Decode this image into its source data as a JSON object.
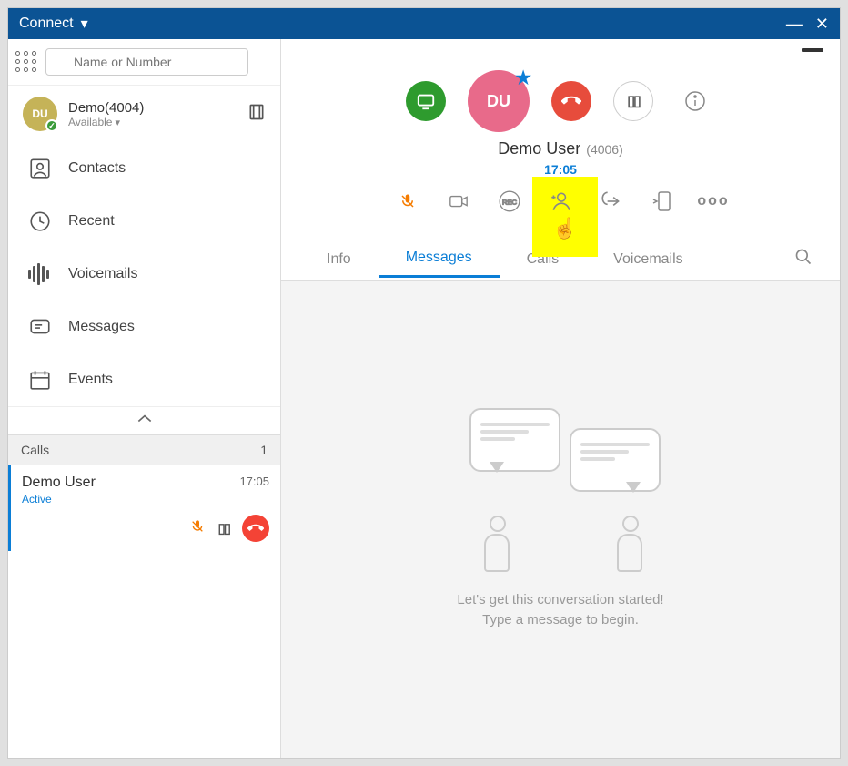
{
  "app_title": "Connect",
  "search": {
    "placeholder": "Name or Number"
  },
  "profile": {
    "initials": "DU",
    "name": "Demo(4004)",
    "status": "Available"
  },
  "nav": {
    "contacts": "Contacts",
    "recent": "Recent",
    "voicemails": "Voicemails",
    "messages": "Messages",
    "events": "Events"
  },
  "calls_section": {
    "header": "Calls",
    "count": "1",
    "item": {
      "name": "Demo User",
      "time": "17:05",
      "status": "Active"
    }
  },
  "hero": {
    "initials": "DU",
    "name": "Demo User",
    "ext": "(4006)",
    "timer": "17:05",
    "more": "ooo"
  },
  "tabs": {
    "info": "Info",
    "messages": "Messages",
    "calls": "Calls",
    "voicemails": "Voicemails"
  },
  "empty": {
    "line1": "Let's get this conversation started!",
    "line2": "Type a message to begin."
  }
}
